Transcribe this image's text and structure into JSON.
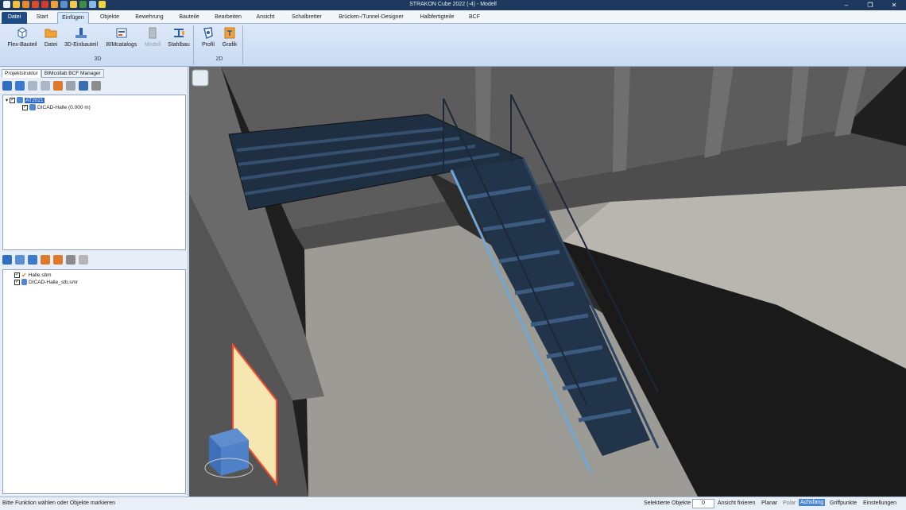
{
  "window": {
    "title": "STRAKON Cube 2022 (-4) - Modell",
    "controls": [
      "–",
      "❐",
      "✕"
    ]
  },
  "quick_access": [
    "strakon-icon",
    "new-icon",
    "open-icon",
    "save-icon",
    "undo-icon",
    "redo-icon",
    "print-icon",
    "bim-icon",
    "cube-icon",
    "help-icon",
    "arrow-icon"
  ],
  "tabs": [
    {
      "label": "Datei"
    },
    {
      "label": "Start"
    },
    {
      "label": "Einfügen"
    },
    {
      "label": "Objekte"
    },
    {
      "label": "Bewehrung"
    },
    {
      "label": "Bauteile"
    },
    {
      "label": "Bearbeiten"
    },
    {
      "label": "Ansicht"
    },
    {
      "label": "Schalbretter"
    },
    {
      "label": "Brücken-/Tunnel-Designer"
    },
    {
      "label": "Halbfertigteile"
    },
    {
      "label": "BCF"
    }
  ],
  "ribbon": {
    "buttons": [
      {
        "label": "Flex-Bauteil"
      },
      {
        "label": "Datei"
      },
      {
        "label": "3D-Einbauteil"
      },
      {
        "label": "BIMcatalogs"
      },
      {
        "label": "Modell"
      },
      {
        "label": "Stahlbau"
      },
      {
        "label": "Profil"
      },
      {
        "label": "Grafik"
      }
    ],
    "groups": [
      {
        "label": "3D"
      },
      {
        "label": "2D"
      }
    ]
  },
  "panel_tabs": [
    {
      "label": "Projektstruktur"
    },
    {
      "label": "BIMcollab BCF Manager"
    }
  ],
  "project_tree": {
    "root": "AT2021",
    "child": "DICAD-Halle (0.000 m)"
  },
  "file_tree": {
    "items": [
      "Halle.sbm",
      "DICAD-Halle_stb.smr"
    ]
  },
  "status": {
    "prompt": "Bitte Funktion wählen oder Objekte markieren",
    "selected_label": "Selektierte Objekte",
    "selected_count": "0",
    "fix_view": "Ansicht fixieren",
    "planar": "Planar",
    "polar": "Polar",
    "axis_snap": "Achsfang",
    "grips": "Griffpunkte",
    "settings": "Einstellungen"
  },
  "colors": {
    "title_bar": "#1d3a5e",
    "accent": "#2a66c9",
    "steel": "#1f2f42",
    "selection": "#ff4a2a"
  }
}
